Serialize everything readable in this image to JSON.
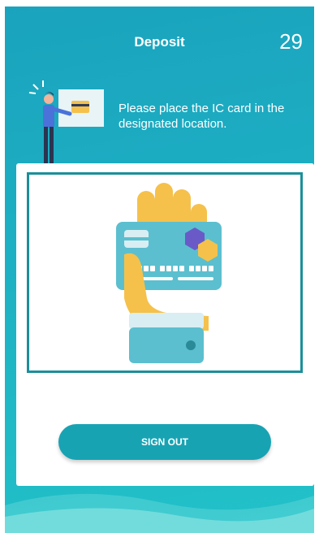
{
  "header": {
    "title": "Deposit",
    "countdown": "29"
  },
  "instruction": {
    "text": "Please place the IC card in the designated location."
  },
  "actions": {
    "sign_out_label": "SIGN OUT"
  },
  "colors": {
    "accent": "#18a3b3",
    "frame": "#1b8f9a",
    "background": "#1db0c4"
  }
}
